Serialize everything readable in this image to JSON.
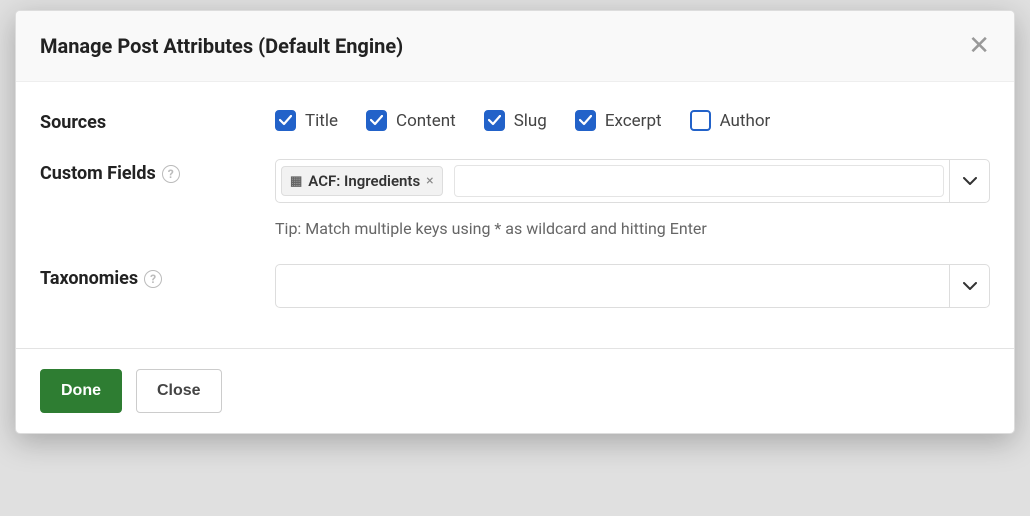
{
  "modal": {
    "title": "Manage Post Attributes (Default Engine)"
  },
  "sources": {
    "label": "Sources",
    "options": [
      {
        "label": "Title",
        "checked": true
      },
      {
        "label": "Content",
        "checked": true
      },
      {
        "label": "Slug",
        "checked": true
      },
      {
        "label": "Excerpt",
        "checked": true
      },
      {
        "label": "Author",
        "checked": false
      }
    ]
  },
  "customFields": {
    "label": "Custom Fields",
    "tags": [
      {
        "label": "ACF: Ingredients"
      }
    ],
    "tip": "Tip: Match multiple keys using * as wildcard and hitting Enter"
  },
  "taxonomies": {
    "label": "Taxonomies"
  },
  "footer": {
    "done": "Done",
    "close": "Close"
  }
}
